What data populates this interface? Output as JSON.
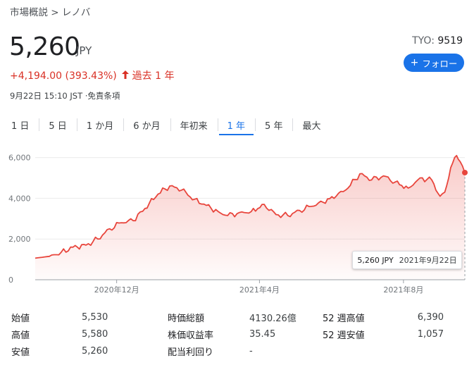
{
  "breadcrumb": "市場概説 > レノバ",
  "price": "5,260",
  "currency": "JPY",
  "change": "+4,194.00 (393.43%)",
  "change_period": "過去 1 年",
  "timestamp": "9月22日 15:10 JST ·免責条項",
  "ticker": {
    "exchange": "TYO:",
    "code": "9519"
  },
  "follow_label": "フォロー",
  "tabs": [
    {
      "label": "1 日",
      "active": false
    },
    {
      "label": "5 日",
      "active": false
    },
    {
      "label": "1 か月",
      "active": false
    },
    {
      "label": "6 か月",
      "active": false
    },
    {
      "label": "年初来",
      "active": false
    },
    {
      "label": "1 年",
      "active": true
    },
    {
      "label": "5 年",
      "active": false
    },
    {
      "label": "最大",
      "active": false
    }
  ],
  "tooltip": {
    "value": "5,260 JPY",
    "date": "2021年9月22日"
  },
  "colors": {
    "line": "#e8453c",
    "accent": "#1a73e8",
    "negative": "#d93025"
  },
  "stats": [
    [
      {
        "label": "始値",
        "value": "5,530"
      },
      {
        "label": "時価総額",
        "value": "4130.26億"
      },
      {
        "label": "52 週高値",
        "value": "6,390"
      }
    ],
    [
      {
        "label": "高値",
        "value": "5,580"
      },
      {
        "label": "株価収益率",
        "value": "35.45"
      },
      {
        "label": "52 週安値",
        "value": "1,057"
      }
    ],
    [
      {
        "label": "安値",
        "value": "5,260"
      },
      {
        "label": "配当利回り",
        "value": "-"
      },
      {
        "label": "",
        "value": ""
      }
    ]
  ],
  "chart_data": {
    "type": "area",
    "x_labels": [
      "2020年12月",
      "2021年4月",
      "2021年8月"
    ],
    "y_ticks": [
      "0",
      "2,000",
      "4,000",
      "6,000"
    ],
    "ylim": [
      0,
      6400
    ],
    "series": [
      {
        "x": [
          "2020-09-23",
          "2020-10-05",
          "2020-10-15",
          "2020-10-25",
          "2020-11-05",
          "2020-11-15",
          "2020-11-25",
          "2020-12-05",
          "2020-12-15",
          "2020-12-25",
          "2021-01-05",
          "2021-01-15",
          "2021-01-25",
          "2021-02-05",
          "2021-02-15",
          "2021-02-25",
          "2021-03-05",
          "2021-03-15",
          "2021-03-25",
          "2021-04-05",
          "2021-04-15",
          "2021-04-25",
          "2021-05-05",
          "2021-05-15",
          "2021-05-25",
          "2021-06-05",
          "2021-06-15",
          "2021-06-25",
          "2021-07-05",
          "2021-07-15",
          "2021-07-25",
          "2021-08-05",
          "2021-08-15",
          "2021-08-25",
          "2021-09-01",
          "2021-09-05",
          "2021-09-10",
          "2021-09-15",
          "2021-09-18",
          "2021-09-22"
        ],
        "values": [
          1060,
          1150,
          1350,
          1600,
          1700,
          2000,
          2500,
          2800,
          2900,
          3500,
          4200,
          4600,
          4400,
          3950,
          3650,
          3350,
          3150,
          3300,
          3350,
          3700,
          3200,
          3150,
          3400,
          3600,
          3800,
          4100,
          4500,
          5200,
          4900,
          5100,
          4800,
          4500,
          5000,
          4900,
          4100,
          4300,
          5500,
          6100,
          5800,
          5260
        ]
      }
    ]
  }
}
